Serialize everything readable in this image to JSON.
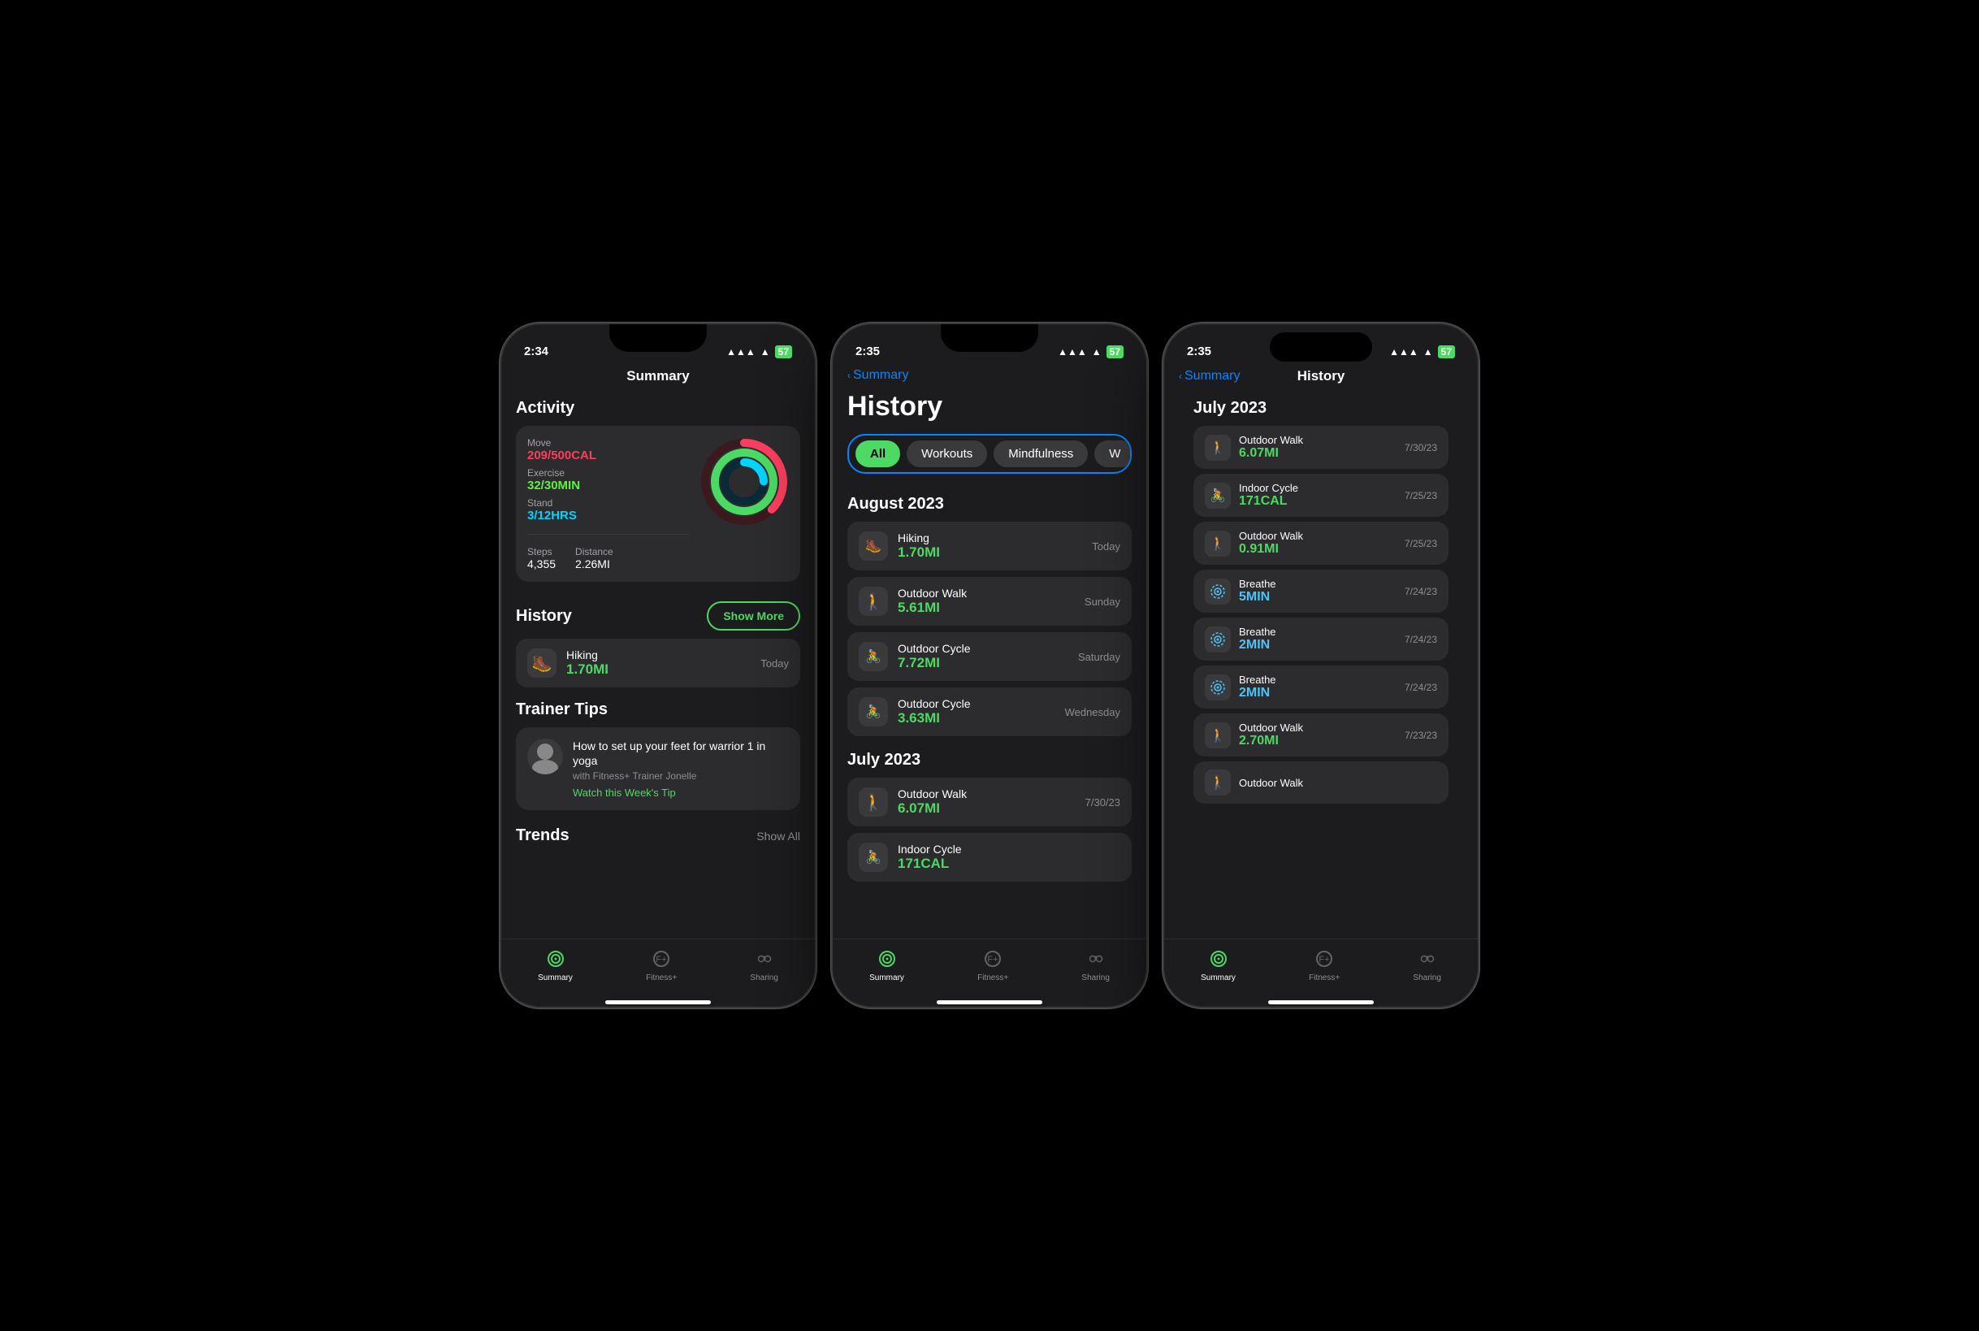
{
  "phones": [
    {
      "id": "phone1",
      "statusBar": {
        "time": "2:34",
        "signal": "●●●",
        "wifi": "WiFi",
        "battery": "57"
      },
      "pageTitle": "Summary",
      "activity": {
        "sectionTitle": "Activity",
        "move": {
          "label": "Move",
          "value": "209/500CAL"
        },
        "exercise": {
          "label": "Exercise",
          "value": "32/30MIN"
        },
        "stand": {
          "label": "Stand",
          "value": "3/12HRS"
        },
        "steps": {
          "label": "Steps",
          "value": "4,355"
        },
        "distance": {
          "label": "Distance",
          "value": "2.26MI"
        }
      },
      "history": {
        "sectionTitle": "History",
        "showMoreLabel": "Show More",
        "items": [
          {
            "type": "hike",
            "name": "Hiking",
            "value": "1.70MI",
            "date": "Today"
          }
        ]
      },
      "trainerTips": {
        "sectionTitle": "Trainer Tips",
        "title": "How to set up your feet for warrior 1 in yoga",
        "subtitle": "with Fitness+ Trainer Jonelle",
        "linkLabel": "Watch this Week's Tip"
      },
      "trends": {
        "sectionTitle": "Trends",
        "showAllLabel": "Show All"
      },
      "nav": {
        "items": [
          {
            "label": "Summary",
            "active": true
          },
          {
            "label": "Fitness+",
            "active": false
          },
          {
            "label": "Sharing",
            "active": false
          }
        ]
      }
    },
    {
      "id": "phone2",
      "statusBar": {
        "time": "2:35",
        "signal": "●●●",
        "wifi": "WiFi",
        "battery": "57"
      },
      "backLabel": "Summary",
      "pageTitle": "History",
      "filterTabs": [
        {
          "label": "All",
          "active": true
        },
        {
          "label": "Workouts",
          "active": false
        },
        {
          "label": "Mindfulness",
          "active": false
        },
        {
          "label": "W",
          "active": false
        }
      ],
      "sections": [
        {
          "month": "August 2023",
          "items": [
            {
              "type": "hike",
              "name": "Hiking",
              "value": "1.70MI",
              "date": "Today"
            },
            {
              "type": "walk",
              "name": "Outdoor Walk",
              "value": "5.61MI",
              "date": "Sunday"
            },
            {
              "type": "cycle",
              "name": "Outdoor Cycle",
              "value": "7.72MI",
              "date": "Saturday"
            },
            {
              "type": "cycle",
              "name": "Outdoor Cycle",
              "value": "3.63MI",
              "date": "Wednesday"
            }
          ]
        },
        {
          "month": "July 2023",
          "items": [
            {
              "type": "walk",
              "name": "Outdoor Walk",
              "value": "6.07MI",
              "date": "7/30/23"
            },
            {
              "type": "indoor-cycle",
              "name": "Indoor Cycle",
              "value": "171CAL",
              "date": ""
            }
          ]
        }
      ],
      "nav": {
        "items": [
          {
            "label": "Summary",
            "active": true
          },
          {
            "label": "Fitness+",
            "active": false
          },
          {
            "label": "Sharing",
            "active": false
          }
        ]
      }
    },
    {
      "id": "phone3",
      "statusBar": {
        "time": "2:35",
        "signal": "●●●",
        "wifi": "WiFi",
        "battery": "57"
      },
      "backLabel": "Summary",
      "pageTitle": "History",
      "sections": [
        {
          "month": "July 2023",
          "items": [
            {
              "type": "walk",
              "name": "Outdoor Walk",
              "value": "6.07MI",
              "date": "7/30/23"
            },
            {
              "type": "indoor-cycle",
              "name": "Indoor Cycle",
              "value": "171CAL",
              "date": "7/25/23"
            },
            {
              "type": "walk",
              "name": "Outdoor Walk",
              "value": "0.91MI",
              "date": "7/25/23"
            },
            {
              "type": "breathe",
              "name": "Breathe",
              "value": "5MIN",
              "date": "7/24/23"
            },
            {
              "type": "breathe",
              "name": "Breathe",
              "value": "2MIN",
              "date": "7/24/23"
            },
            {
              "type": "breathe",
              "name": "Breathe",
              "value": "2MIN",
              "date": "7/24/23"
            },
            {
              "type": "walk",
              "name": "Outdoor Walk",
              "value": "2.70MI",
              "date": "7/23/23"
            },
            {
              "type": "walk",
              "name": "Outdoor Walk",
              "value": "...",
              "date": ""
            }
          ]
        }
      ],
      "nav": {
        "items": [
          {
            "label": "Summary",
            "active": true
          },
          {
            "label": "Fitness+",
            "active": false
          },
          {
            "label": "Sharing",
            "active": false
          }
        ]
      }
    }
  ]
}
